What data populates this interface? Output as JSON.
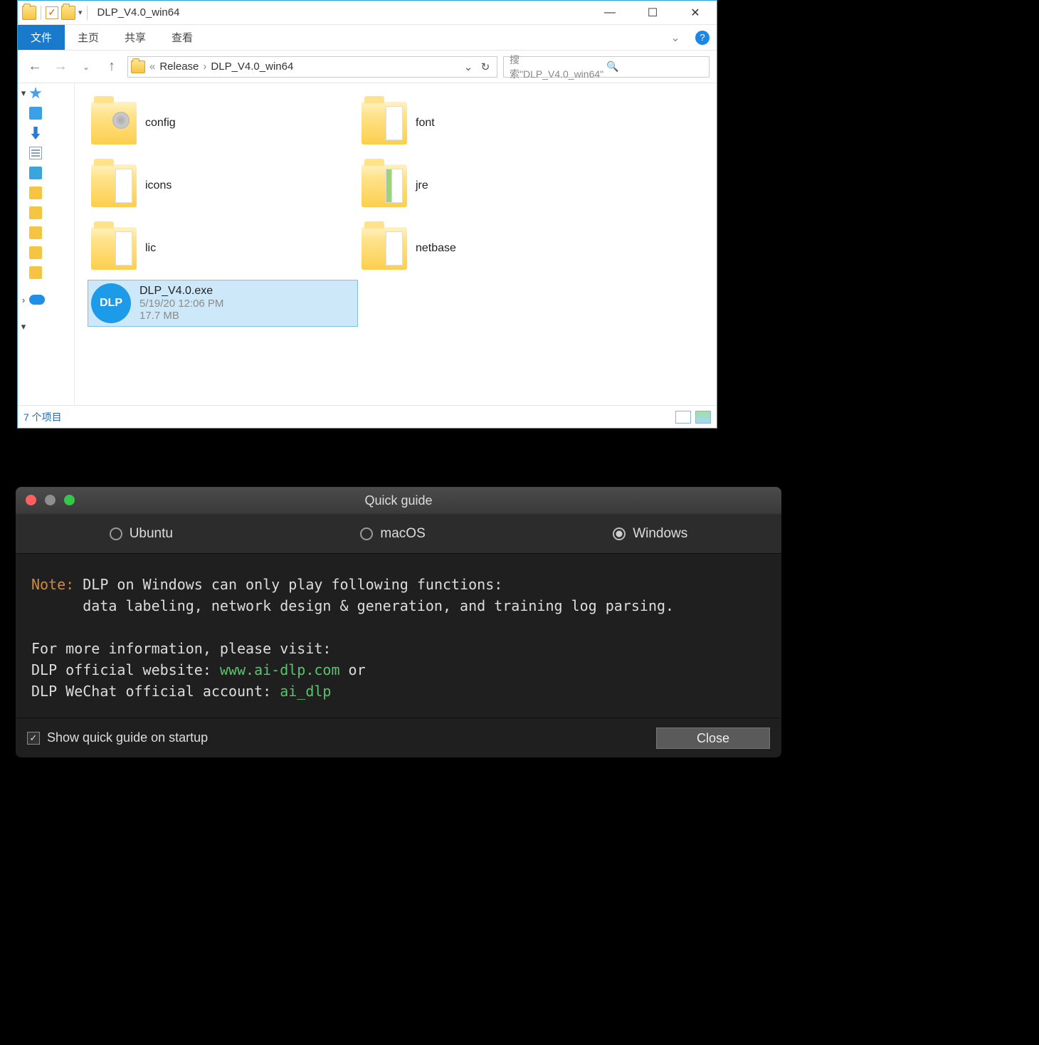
{
  "win": {
    "title": "DLP_V4.0_win64",
    "ribbon": {
      "file": "文件",
      "home": "主页",
      "share": "共享",
      "view": "查看"
    },
    "breadcrumb": {
      "root": "Release",
      "current": "DLP_V4.0_win64"
    },
    "search_placeholder": "搜索\"DLP_V4.0_win64\"",
    "status": "7 个项目",
    "items": [
      {
        "name": "config",
        "kind": "folder-cfg"
      },
      {
        "name": "font",
        "kind": "folder"
      },
      {
        "name": "icons",
        "kind": "folder"
      },
      {
        "name": "jre",
        "kind": "folder-jre"
      },
      {
        "name": "lic",
        "kind": "folder"
      },
      {
        "name": "netbase",
        "kind": "folder"
      },
      {
        "name": "DLP_V4.0.exe",
        "kind": "exe",
        "icon_text": "DLP",
        "sub1": "5/19/20 12:06 PM",
        "sub2": "17.7 MB",
        "selected": true
      }
    ]
  },
  "guide": {
    "title": "Quick guide",
    "tabs": {
      "ubuntu": "Ubuntu",
      "macos": "macOS",
      "windows": "Windows",
      "selected": "windows"
    },
    "note_kw": "Note:",
    "note_line1": "DLP on Windows can only play following functions:",
    "note_line2": "data labeling, network design & generation, and training log parsing.",
    "more": "For more information, please visit:",
    "site_label": "DLP official website: ",
    "site_url": "www.ai-dlp.com",
    "site_or": " or",
    "wechat_label": "DLP WeChat official account: ",
    "wechat_id": "ai_dlp",
    "show_on_startup": "Show quick guide on startup",
    "show_checked": true,
    "close": "Close"
  }
}
